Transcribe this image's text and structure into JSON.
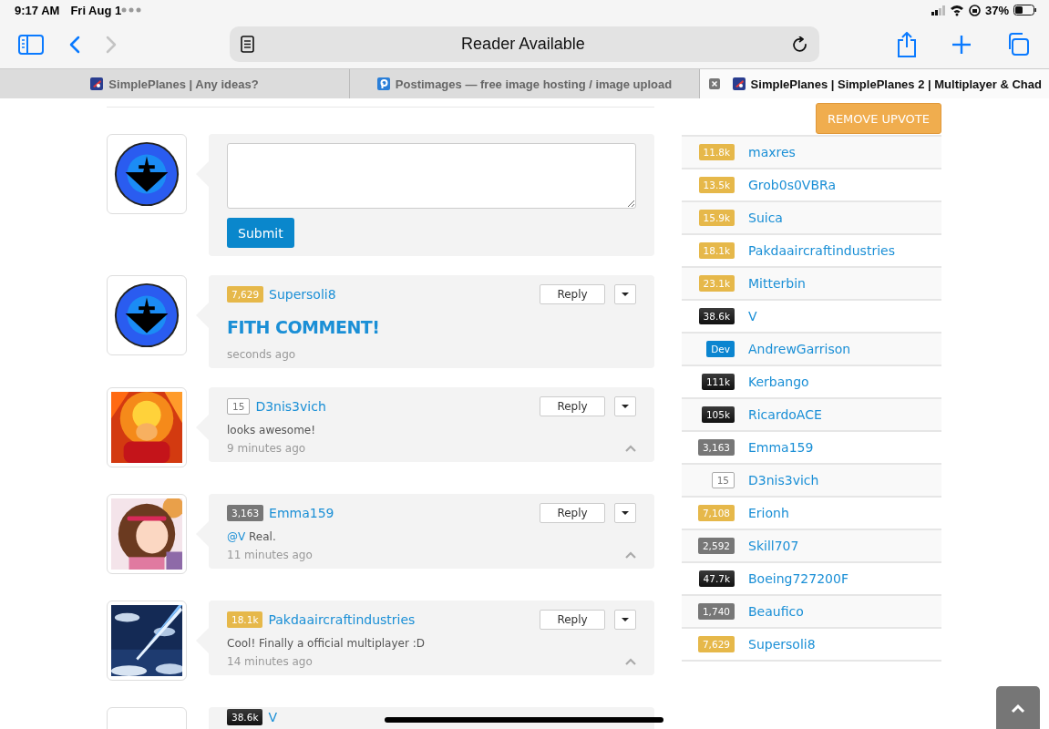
{
  "status_bar": {
    "time": "9:17 AM",
    "date": "Fri Aug 1",
    "battery": "37%"
  },
  "toolbar": {
    "address": "Reader Available",
    "forward_disabled": true
  },
  "tabs": [
    {
      "title": "SimplePlanes | Any ideas?",
      "kind": "simpleplanes",
      "selected": false
    },
    {
      "title": "Postimages — free image hosting / image upload",
      "kind": "postimages",
      "selected": false
    },
    {
      "title": "SimplePlanes | SimplePlanes 2 | Multiplayer & Chad",
      "kind": "simpleplanes",
      "selected": true
    }
  ],
  "comment_form": {
    "button": "Submit"
  },
  "comments": [
    {
      "badge": {
        "text": "7,629",
        "kind": "gold"
      },
      "author": "Supersoli8",
      "kind": "heading",
      "text": "FITH COMMENT!",
      "time": "seconds ago",
      "reply": "Reply",
      "collapsible": false
    },
    {
      "badge": {
        "text": "15",
        "kind": "outline"
      },
      "author": "D3nis3vich",
      "kind": "text",
      "text": "looks awesome!",
      "time": "9 minutes ago",
      "reply": "Reply",
      "collapsible": true
    },
    {
      "badge": {
        "text": "3,163",
        "kind": "gray"
      },
      "author": "Emma159",
      "kind": "text",
      "mention": "@V",
      "text": "Real.",
      "time": "11 minutes ago",
      "reply": "Reply",
      "collapsible": true
    },
    {
      "badge": {
        "text": "18.1k",
        "kind": "gold"
      },
      "author": "Pakdaaircraftindustries",
      "kind": "text",
      "text": "Cool! Finally a official multiplayer :D",
      "time": "14 minutes ago",
      "reply": "Reply",
      "collapsible": true
    },
    {
      "badge": {
        "text": "38.6k",
        "kind": "black"
      },
      "author": "V"
    }
  ],
  "sidebar": {
    "button": "REMOVE UPVOTE",
    "upvoters": [
      {
        "badge": {
          "text": "11.8k",
          "kind": "gold"
        },
        "name": "maxres"
      },
      {
        "badge": {
          "text": "13.5k",
          "kind": "gold"
        },
        "name": "Grob0s0VBRa"
      },
      {
        "badge": {
          "text": "15.9k",
          "kind": "gold"
        },
        "name": "Suica"
      },
      {
        "badge": {
          "text": "18.1k",
          "kind": "gold"
        },
        "name": "Pakdaaircraftindustries"
      },
      {
        "badge": {
          "text": "23.1k",
          "kind": "gold"
        },
        "name": "Mitterbin"
      },
      {
        "badge": {
          "text": "38.6k",
          "kind": "black"
        },
        "name": "V"
      },
      {
        "badge": {
          "text": "Dev",
          "kind": "dev"
        },
        "name": "AndrewGarrison"
      },
      {
        "badge": {
          "text": "111k",
          "kind": "black"
        },
        "name": "Kerbango"
      },
      {
        "badge": {
          "text": "105k",
          "kind": "black"
        },
        "name": "RicardoACE"
      },
      {
        "badge": {
          "text": "3,163",
          "kind": "gray"
        },
        "name": "Emma159"
      },
      {
        "badge": {
          "text": "15",
          "kind": "outline"
        },
        "name": "D3nis3vich"
      },
      {
        "badge": {
          "text": "7,108",
          "kind": "gold"
        },
        "name": "Erionh"
      },
      {
        "badge": {
          "text": "2,592",
          "kind": "gray"
        },
        "name": "Skill707"
      },
      {
        "badge": {
          "text": "47.7k",
          "kind": "black"
        },
        "name": "Boeing727200F"
      },
      {
        "badge": {
          "text": "1,740",
          "kind": "gray"
        },
        "name": "Beaufico"
      },
      {
        "badge": {
          "text": "7,629",
          "kind": "gold"
        },
        "name": "Supersoli8"
      }
    ]
  }
}
